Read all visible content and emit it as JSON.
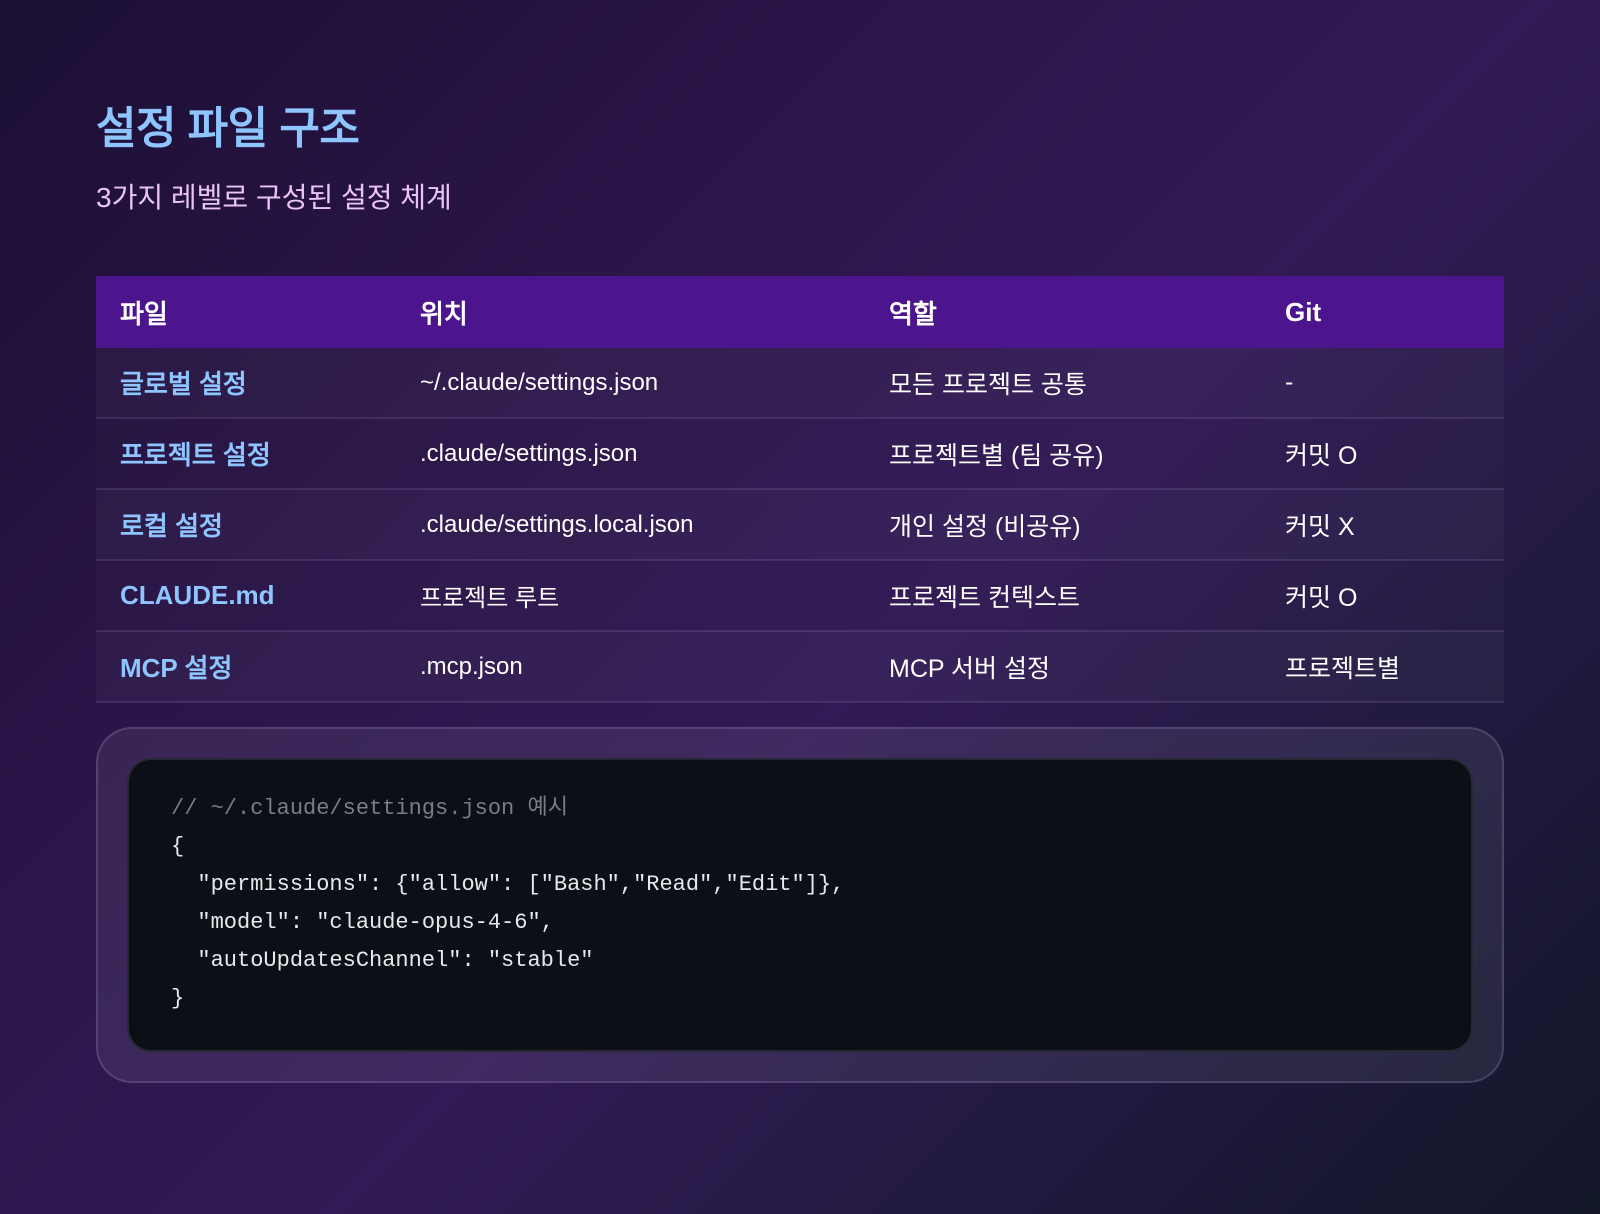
{
  "page": {
    "title": "설정 파일 구조",
    "subtitle": "3가지 레벨로 구성된 설정 체계"
  },
  "table": {
    "headers": [
      "파일",
      "위치",
      "역할",
      "Git"
    ],
    "rows": [
      {
        "file": "글로벌 설정",
        "location": "~/.claude/settings.json",
        "role": "모든 프로젝트 공통",
        "git": "-"
      },
      {
        "file": "프로젝트 설정",
        "location": ".claude/settings.json",
        "role": "프로젝트별 (팀 공유)",
        "git": "커밋 O"
      },
      {
        "file": "로컬 설정",
        "location": ".claude/settings.local.json",
        "role": "개인 설정 (비공유)",
        "git": "커밋 X"
      },
      {
        "file": "CLAUDE.md",
        "location": "프로젝트 루트",
        "role": "프로젝트 컨텍스트",
        "git": "커밋 O"
      },
      {
        "file": "MCP 설정",
        "location": ".mcp.json",
        "role": "MCP 서버 설정",
        "git": "프로젝트별"
      }
    ]
  },
  "code": {
    "comment": "// ~/.claude/settings.json 예시",
    "lines": [
      "{",
      "  \"permissions\": {\"allow\": [\"Bash\",\"Read\",\"Edit\"]},",
      "  \"model\": \"claude-opus-4-6\",",
      "  \"autoUpdatesChannel\": \"stable\"",
      "}"
    ]
  },
  "colors": {
    "title": "#8ec5ff",
    "subtitle": "#eac4f5",
    "table_header_bg": "#4c158e",
    "git_committed": "#4cc15e",
    "code_bg": "#0c0f16",
    "code_comment": "#7a7d88"
  }
}
